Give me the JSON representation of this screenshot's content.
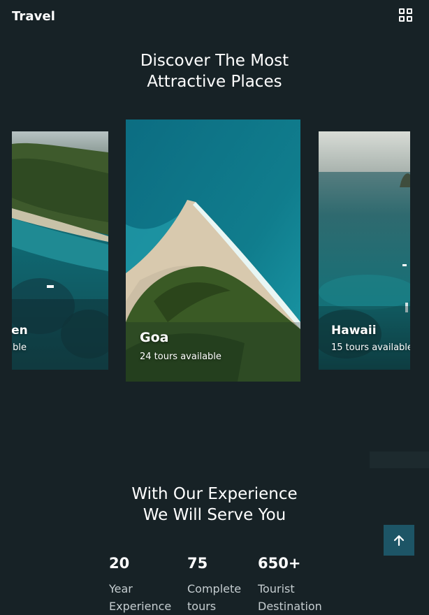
{
  "header": {
    "logo": "Travel",
    "menu_icon": "grid-icon"
  },
  "destinations": {
    "title_line1": "Discover The Most",
    "title_line2": "Attractive Places",
    "cards": [
      {
        "name": "ven",
        "subtitle": "ailable"
      },
      {
        "name": "Goa",
        "subtitle": "24 tours available"
      },
      {
        "name": "Hawaii",
        "subtitle": "15 tours available"
      }
    ]
  },
  "experience": {
    "title_line1": "With Our Experience",
    "title_line2": "We Will Serve You",
    "stats": [
      {
        "value": "20",
        "label_line1": "Year",
        "label_line2": "Experience"
      },
      {
        "value": "75",
        "label_line1": "Complete",
        "label_line2": "tours"
      },
      {
        "value": "650+",
        "label_line1": "Tourist",
        "label_line2": "Destination"
      }
    ]
  },
  "scroll_top_icon": "arrow-up-icon",
  "colors": {
    "background": "#172226",
    "text": "#ffffff",
    "muted_text": "#c5cdd0",
    "scroll_button": "#1d5566"
  }
}
